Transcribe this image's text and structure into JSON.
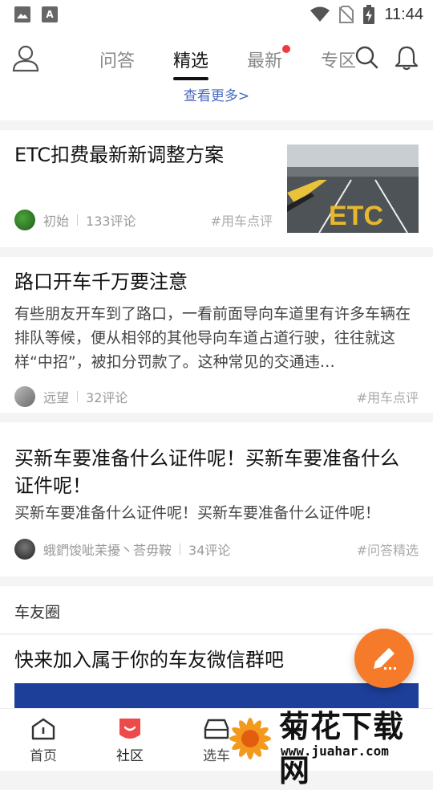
{
  "status_bar": {
    "time": "11:44",
    "left_icons": [
      "image-icon",
      "a-app-icon"
    ],
    "right_icons": [
      "wifi-icon",
      "no-sim-icon",
      "battery-charging-icon"
    ],
    "app_icon_letter": "A"
  },
  "header": {
    "tabs": [
      {
        "label": "问答",
        "active": false,
        "badge": false
      },
      {
        "label": "精选",
        "active": true,
        "badge": false
      },
      {
        "label": "最新",
        "active": false,
        "badge": true
      },
      {
        "label": "专区",
        "active": false,
        "badge": false
      }
    ],
    "icons": [
      "user-icon",
      "search-icon",
      "bell-icon"
    ],
    "see_more": "查看更多>"
  },
  "feed": [
    {
      "title": "ETC扣费最新新调整方案",
      "summary": "",
      "author": "初始",
      "comments": "133评论",
      "tag": "#用车点评",
      "has_thumb": true,
      "thumb_text": "ETC"
    },
    {
      "title": "路口开车千万要注意",
      "summary": "有些朋友开车到了路口，一看前面导向车道里有许多车辆在排队等候，便从相邻的其他导向车道占道行驶，往往就这样“中招”，被扣分罚款了。这种常见的交通违…",
      "author": "远望",
      "comments": "32评论",
      "tag": "#用车点评",
      "has_thumb": false
    },
    {
      "title": "买新车要准备什么证件呢！买新车要准备什么证件呢！",
      "summary": "买新车要准备什么证件呢！买新车要准备什么证件呢！",
      "author": "蛾鍆馂呲苿擾丶荅毋鞍",
      "comments": "34评论",
      "tag": "#问答精选",
      "has_thumb": false
    }
  ],
  "circle": {
    "section_title": "车友圈",
    "post_title": "快来加入属于你的车友微信群吧"
  },
  "bottom_nav": [
    {
      "label": "首页",
      "icon": "home-icon",
      "active": false
    },
    {
      "label": "社区",
      "icon": "community-icon",
      "active": true
    },
    {
      "label": "选车",
      "icon": "car-icon",
      "active": false
    }
  ],
  "watermark": {
    "title": "菊花下载网",
    "url": "www.juahar.com"
  },
  "colors": {
    "accent": "#f57b2a",
    "badge_red": "#ee3a3a",
    "link_blue": "#4a6ac0",
    "community_red": "#ef4a4a",
    "banner_blue": "#1e3f99"
  }
}
